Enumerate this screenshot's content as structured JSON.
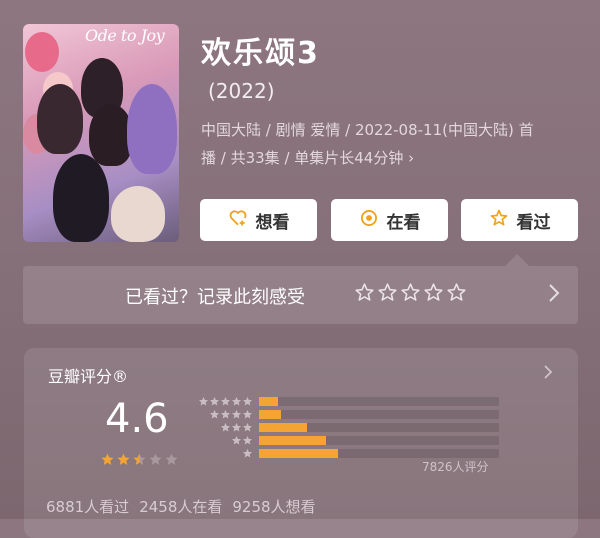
{
  "poster": {
    "logo_text": "Ode to Joy"
  },
  "movie": {
    "title": "欢乐颂3",
    "year": "(2022)",
    "meta_line1": "中国大陆 / 剧情 爱情 / 2022-08-11(中国大陆) 首",
    "meta_line2": "播 / 共33集 / 单集片长44分钟",
    "meta_chevron": "›"
  },
  "actions": [
    {
      "label": "想看",
      "icon": "heart-plus-icon"
    },
    {
      "label": "在看",
      "icon": "target-circle-icon"
    },
    {
      "label": "看过",
      "icon": "star-outline-icon"
    }
  ],
  "review_prompt": {
    "text": "已看过？记录此刻感受",
    "stars": 5,
    "chevron": "›"
  },
  "rating": {
    "title": "豆瓣评分®",
    "score": "4.6",
    "star_value": 2.5,
    "distribution": [
      0.08,
      0.09,
      0.2,
      0.28,
      0.33
    ],
    "count_label": "7826人评分",
    "chevron": "›"
  },
  "stats": [
    "6881人看过",
    "2458人在看",
    "9258人想看"
  ],
  "colors": {
    "accent": "#f4a433",
    "button_bg": "#ffffff",
    "icon_orange": "#f0a21a"
  }
}
